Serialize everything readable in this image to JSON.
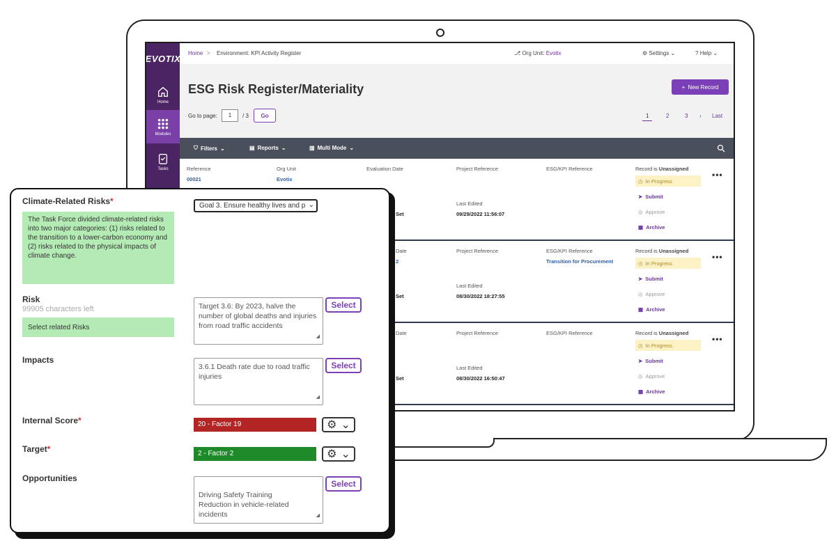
{
  "app": {
    "logo": "EVOTIX",
    "sidebar": [
      {
        "label": "Home",
        "icon": "home-icon"
      },
      {
        "label": "Modules",
        "icon": "grid-icon"
      },
      {
        "label": "Tasks",
        "icon": "clipboard-icon"
      }
    ]
  },
  "topbar": {
    "breadcrumb_home": "Home",
    "breadcrumb_sep": ">",
    "breadcrumb_page": "Environment: KPI Activity Register",
    "org_label": "Org Unit:",
    "org_value": "Evotix",
    "settings": "Settings",
    "help": "Help"
  },
  "header": {
    "title": "ESG Risk Register/Materiality",
    "new_record": "New Record",
    "goto_label": "Go to page:",
    "goto_value": "1",
    "goto_total": "/ 3",
    "go_button": "Go",
    "pages": [
      "1",
      "2",
      "3"
    ],
    "last": "Last"
  },
  "toolbar": {
    "filters": "Filters",
    "reports": "Reports",
    "multi_mode": "Multi Mode"
  },
  "records": [
    {
      "reference_label": "Reference",
      "reference": "00021",
      "org_label": "Org Unit",
      "org": "Evotix",
      "eval_label": "Evaluation Date",
      "project_label": "Project Reference",
      "esg_label": "ESG/KPI Reference",
      "esg": "",
      "last_edited_label": "Last Edited",
      "last_edited": "09/29/2022 11:56:07",
      "not_set": "Set",
      "record_is": "Record is",
      "assignment": "Unassigned",
      "status": "In Progress",
      "actions": [
        "Submit",
        "Approve",
        "Archive"
      ]
    },
    {
      "eval_label": "Date",
      "eval_value": "2",
      "project_label": "Project Reference",
      "esg_label": "ESG/KPI Reference",
      "esg": "Transition for Procurement",
      "last_edited_label": "Last Edited",
      "last_edited": "08/30/2022 18:27:55",
      "not_set": "Set",
      "record_is": "Record is",
      "assignment": "Unassigned",
      "status": "In Progress",
      "actions": [
        "Submit",
        "Approve",
        "Archive"
      ]
    },
    {
      "eval_label": "Date",
      "project_label": "Project Reference",
      "esg_label": "ESG/KPI Reference",
      "esg": "",
      "last_edited_label": "Last Edited",
      "last_edited": "08/30/2022 16:50:47",
      "not_set": "Set",
      "record_is": "Record is",
      "assignment": "Unassigned",
      "status": "In Progress",
      "actions": [
        "Submit",
        "Approve",
        "Archive"
      ]
    }
  ],
  "form": {
    "climate_label": "Climate-Related Risks",
    "required_mark": "*",
    "climate_help": "The Task Force divided climate-related risks into two major categories: (1) risks related to the transition to a lower-carbon economy and (2) risks related to the physical impacts of climate change.",
    "goal_select": "Goal 3. Ensure healthy lives and p",
    "risk_label": "Risk",
    "risk_chars_left": "99905 characters left",
    "risk_hint": "Select related Risks",
    "risk_value": "Target 3.6: By 2023, halve the number of global deaths and injuries from road traffic accidents",
    "impacts_label": "Impacts",
    "impacts_value": "3.6.1   Death rate due to road traffic injuries",
    "internal_score_label": "Internal Score",
    "internal_score_value": "20 - Factor 19",
    "target_label": "Target",
    "target_value": "2 - Factor 2",
    "opportunities_label": "Opportunities",
    "opportunities_value": "Driving Safety Training\nReduction in vehicle-related incidents",
    "select_button": "Select",
    "colors": {
      "high": "#b32424",
      "low": "#1f8a2a",
      "help_bg": "#b4ebb4",
      "accent": "#7b3fb8"
    }
  }
}
